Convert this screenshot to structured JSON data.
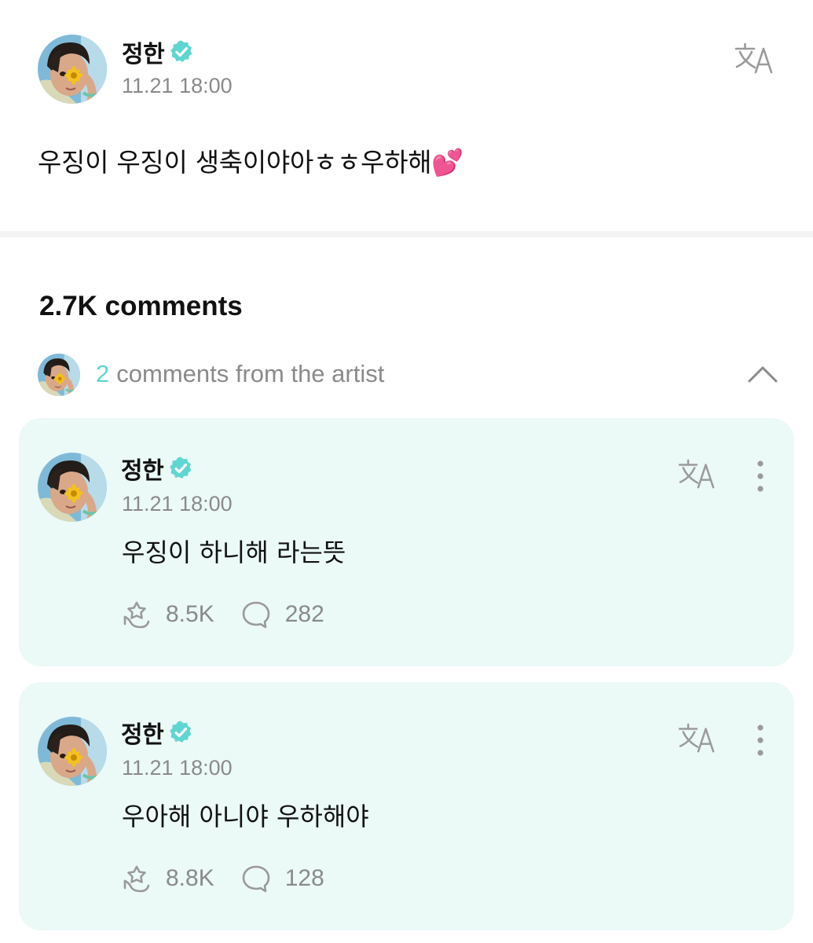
{
  "post": {
    "author": "정한",
    "timestamp": "11.21 18:00",
    "body": "우징이 우징이 생축이야아ㅎㅎ우하해💕",
    "translate_icon": "translate-icon",
    "verified_icon": "verified-badge-icon"
  },
  "comments_section": {
    "count_label": "2.7K comments",
    "artist_row": {
      "count": "2",
      "label": "comments from the artist",
      "toggle_icon": "chevron-up-icon"
    }
  },
  "comments": [
    {
      "author": "정한",
      "timestamp": "11.21 18:00",
      "text": "우징이 하니해 라는뜻",
      "likes": "8.5K",
      "replies": "282"
    },
    {
      "author": "정한",
      "timestamp": "11.21 18:00",
      "text": "우아해 아니야 우하해야",
      "likes": "8.8K",
      "replies": "128"
    }
  ],
  "colors": {
    "accent": "#5fd6d1",
    "card_background": "#ebf9f7",
    "muted_text": "#8a8a8a",
    "icon_gray": "#9a9a9a"
  }
}
